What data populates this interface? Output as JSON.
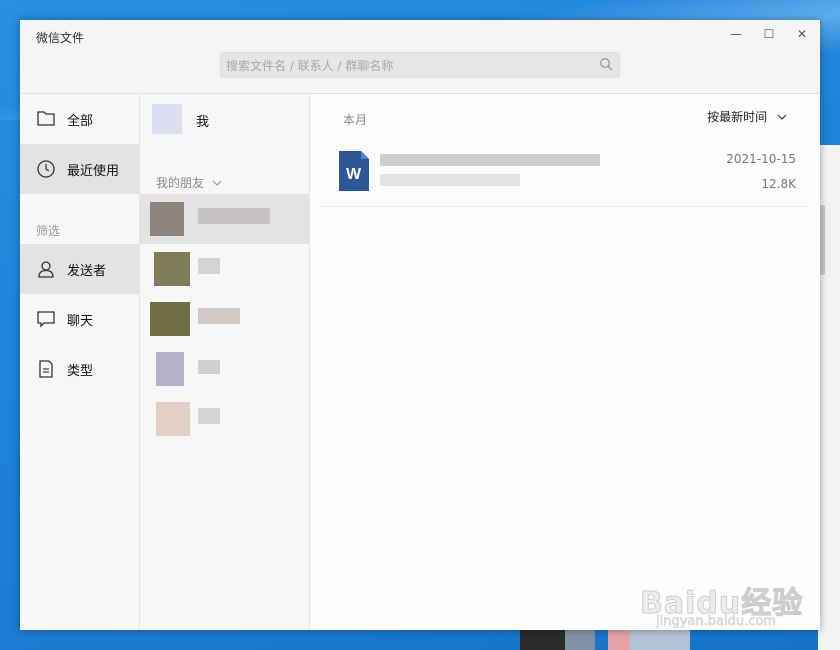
{
  "window": {
    "title": "微信文件",
    "controls": {
      "minimize": "—",
      "maximize": "☐",
      "close": "✕"
    }
  },
  "search": {
    "placeholder": "搜索文件名 / 联系人 / 群聊名称",
    "icon": "search-icon"
  },
  "nav": {
    "items": [
      {
        "label": "全部",
        "icon": "folder-icon",
        "active": false
      },
      {
        "label": "最近使用",
        "icon": "clock-icon",
        "active": true
      },
      {
        "label": "发送者",
        "icon": "person-icon",
        "active": true
      },
      {
        "label": "聊天",
        "icon": "chat-bubble-icon",
        "active": false
      },
      {
        "label": "类型",
        "icon": "document-icon",
        "active": false
      }
    ],
    "section_label": "筛选"
  },
  "contacts": {
    "me_label": "我",
    "friends_header": "我的朋友",
    "friends_count_visible": 5
  },
  "main": {
    "month_label": "本月",
    "sort_label": "按最新时间",
    "files": [
      {
        "type": "word",
        "icon_letter": "W",
        "date": "2021-10-15",
        "size": "12.8K"
      }
    ]
  },
  "colors": {
    "word_blue": "#2b5797",
    "selected_bg": "#e3e3e3",
    "desktop_blue": "#1f84da"
  },
  "watermark": {
    "text": "Baidu经验",
    "sub": "jingyan.baidu.com"
  }
}
